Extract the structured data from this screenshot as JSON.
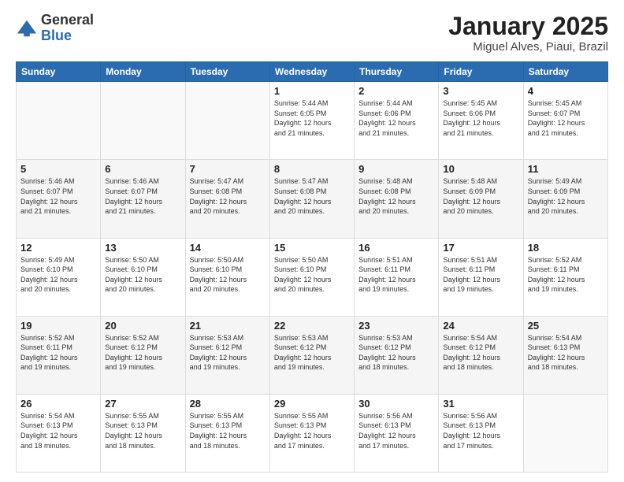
{
  "logo": {
    "general": "General",
    "blue": "Blue"
  },
  "header": {
    "month": "January 2025",
    "location": "Miguel Alves, Piaui, Brazil"
  },
  "weekdays": [
    "Sunday",
    "Monday",
    "Tuesday",
    "Wednesday",
    "Thursday",
    "Friday",
    "Saturday"
  ],
  "weeks": [
    [
      {
        "day": "",
        "info": ""
      },
      {
        "day": "",
        "info": ""
      },
      {
        "day": "",
        "info": ""
      },
      {
        "day": "1",
        "info": "Sunrise: 5:44 AM\nSunset: 6:05 PM\nDaylight: 12 hours\nand 21 minutes."
      },
      {
        "day": "2",
        "info": "Sunrise: 5:44 AM\nSunset: 6:06 PM\nDaylight: 12 hours\nand 21 minutes."
      },
      {
        "day": "3",
        "info": "Sunrise: 5:45 AM\nSunset: 6:06 PM\nDaylight: 12 hours\nand 21 minutes."
      },
      {
        "day": "4",
        "info": "Sunrise: 5:45 AM\nSunset: 6:07 PM\nDaylight: 12 hours\nand 21 minutes."
      }
    ],
    [
      {
        "day": "5",
        "info": "Sunrise: 5:46 AM\nSunset: 6:07 PM\nDaylight: 12 hours\nand 21 minutes."
      },
      {
        "day": "6",
        "info": "Sunrise: 5:46 AM\nSunset: 6:07 PM\nDaylight: 12 hours\nand 21 minutes."
      },
      {
        "day": "7",
        "info": "Sunrise: 5:47 AM\nSunset: 6:08 PM\nDaylight: 12 hours\nand 20 minutes."
      },
      {
        "day": "8",
        "info": "Sunrise: 5:47 AM\nSunset: 6:08 PM\nDaylight: 12 hours\nand 20 minutes."
      },
      {
        "day": "9",
        "info": "Sunrise: 5:48 AM\nSunset: 6:08 PM\nDaylight: 12 hours\nand 20 minutes."
      },
      {
        "day": "10",
        "info": "Sunrise: 5:48 AM\nSunset: 6:09 PM\nDaylight: 12 hours\nand 20 minutes."
      },
      {
        "day": "11",
        "info": "Sunrise: 5:49 AM\nSunset: 6:09 PM\nDaylight: 12 hours\nand 20 minutes."
      }
    ],
    [
      {
        "day": "12",
        "info": "Sunrise: 5:49 AM\nSunset: 6:10 PM\nDaylight: 12 hours\nand 20 minutes."
      },
      {
        "day": "13",
        "info": "Sunrise: 5:50 AM\nSunset: 6:10 PM\nDaylight: 12 hours\nand 20 minutes."
      },
      {
        "day": "14",
        "info": "Sunrise: 5:50 AM\nSunset: 6:10 PM\nDaylight: 12 hours\nand 20 minutes."
      },
      {
        "day": "15",
        "info": "Sunrise: 5:50 AM\nSunset: 6:10 PM\nDaylight: 12 hours\nand 20 minutes."
      },
      {
        "day": "16",
        "info": "Sunrise: 5:51 AM\nSunset: 6:11 PM\nDaylight: 12 hours\nand 19 minutes."
      },
      {
        "day": "17",
        "info": "Sunrise: 5:51 AM\nSunset: 6:11 PM\nDaylight: 12 hours\nand 19 minutes."
      },
      {
        "day": "18",
        "info": "Sunrise: 5:52 AM\nSunset: 6:11 PM\nDaylight: 12 hours\nand 19 minutes."
      }
    ],
    [
      {
        "day": "19",
        "info": "Sunrise: 5:52 AM\nSunset: 6:11 PM\nDaylight: 12 hours\nand 19 minutes."
      },
      {
        "day": "20",
        "info": "Sunrise: 5:52 AM\nSunset: 6:12 PM\nDaylight: 12 hours\nand 19 minutes."
      },
      {
        "day": "21",
        "info": "Sunrise: 5:53 AM\nSunset: 6:12 PM\nDaylight: 12 hours\nand 19 minutes."
      },
      {
        "day": "22",
        "info": "Sunrise: 5:53 AM\nSunset: 6:12 PM\nDaylight: 12 hours\nand 19 minutes."
      },
      {
        "day": "23",
        "info": "Sunrise: 5:53 AM\nSunset: 6:12 PM\nDaylight: 12 hours\nand 18 minutes."
      },
      {
        "day": "24",
        "info": "Sunrise: 5:54 AM\nSunset: 6:12 PM\nDaylight: 12 hours\nand 18 minutes."
      },
      {
        "day": "25",
        "info": "Sunrise: 5:54 AM\nSunset: 6:13 PM\nDaylight: 12 hours\nand 18 minutes."
      }
    ],
    [
      {
        "day": "26",
        "info": "Sunrise: 5:54 AM\nSunset: 6:13 PM\nDaylight: 12 hours\nand 18 minutes."
      },
      {
        "day": "27",
        "info": "Sunrise: 5:55 AM\nSunset: 6:13 PM\nDaylight: 12 hours\nand 18 minutes."
      },
      {
        "day": "28",
        "info": "Sunrise: 5:55 AM\nSunset: 6:13 PM\nDaylight: 12 hours\nand 18 minutes."
      },
      {
        "day": "29",
        "info": "Sunrise: 5:55 AM\nSunset: 6:13 PM\nDaylight: 12 hours\nand 17 minutes."
      },
      {
        "day": "30",
        "info": "Sunrise: 5:56 AM\nSunset: 6:13 PM\nDaylight: 12 hours\nand 17 minutes."
      },
      {
        "day": "31",
        "info": "Sunrise: 5:56 AM\nSunset: 6:13 PM\nDaylight: 12 hours\nand 17 minutes."
      },
      {
        "day": "",
        "info": ""
      }
    ]
  ]
}
